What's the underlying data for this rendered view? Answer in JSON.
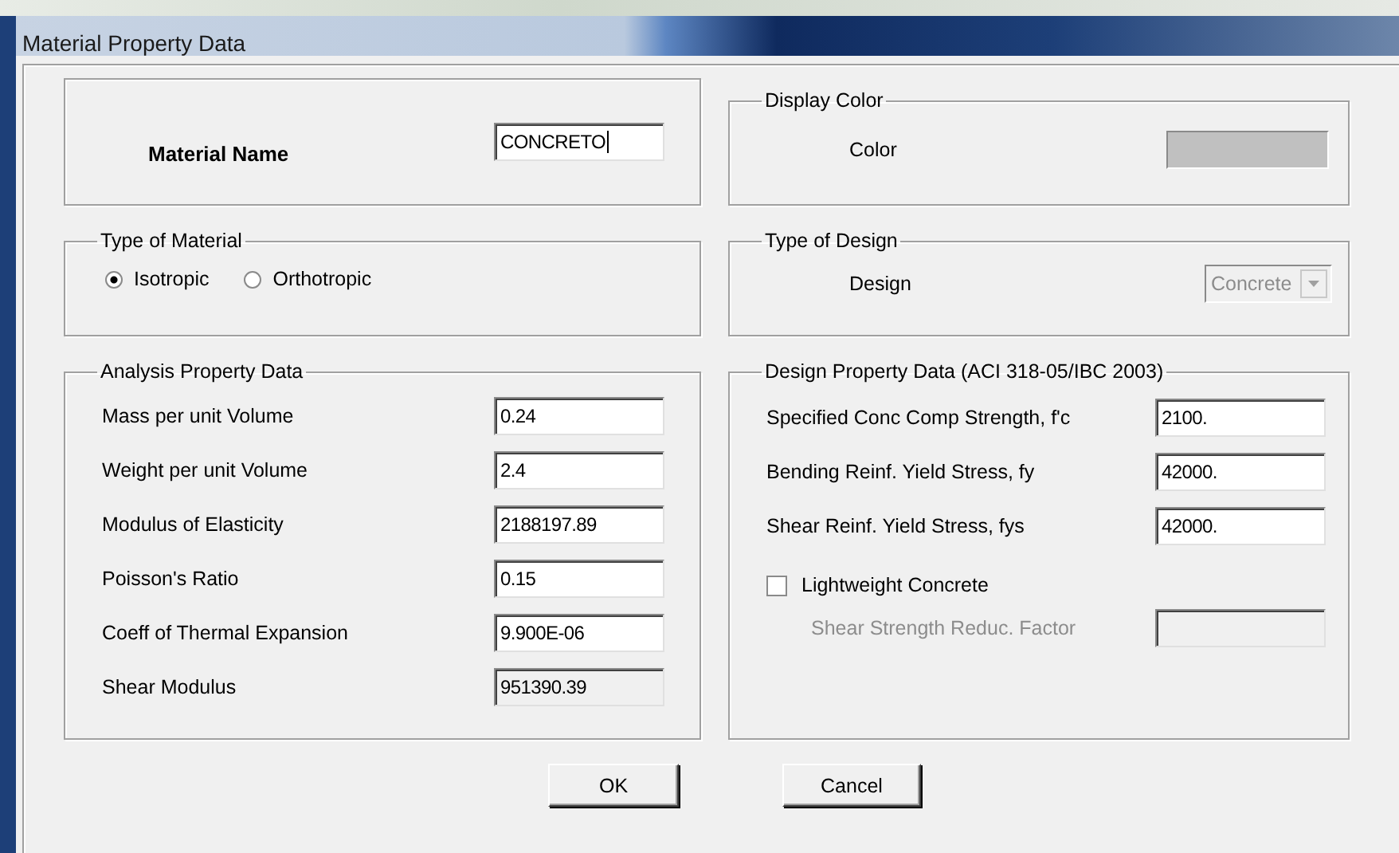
{
  "window": {
    "title": "Material Property Data"
  },
  "material_name": {
    "label": "Material Name",
    "value": "CONCRETO",
    "focused": true
  },
  "type_of_material": {
    "title": "Type of Material",
    "options": [
      {
        "label": "Isotropic",
        "selected": true
      },
      {
        "label": "Orthotropic",
        "selected": false
      }
    ]
  },
  "analysis_property_data": {
    "title": "Analysis Property Data",
    "rows": [
      {
        "label": "Mass per unit Volume",
        "value": "0.24",
        "disabled": false
      },
      {
        "label": "Weight per unit Volume",
        "value": "2.4",
        "disabled": false
      },
      {
        "label": "Modulus of Elasticity",
        "value": "2188197.89",
        "disabled": false
      },
      {
        "label": "Poisson's Ratio",
        "value": "0.15",
        "disabled": false
      },
      {
        "label": "Coeff of Thermal Expansion",
        "value": "9.900E-06",
        "disabled": false
      },
      {
        "label": "Shear Modulus",
        "value": "951390.39",
        "disabled": true
      }
    ]
  },
  "display_color": {
    "title": "Display Color",
    "label": "Color",
    "color": "#c0c0c0"
  },
  "type_of_design": {
    "title": "Type of Design",
    "label": "Design",
    "value": "Concrete",
    "disabled": true
  },
  "design_property_data": {
    "title": "Design Property Data (ACI 318-05/IBC 2003)",
    "rows": [
      {
        "label": "Specified Conc Comp Strength, f'c",
        "value": "2100.",
        "disabled": false
      },
      {
        "label": "Bending Reinf. Yield Stress, fy",
        "value": "42000.",
        "disabled": false
      },
      {
        "label": "Shear Reinf. Yield Stress, fys",
        "value": "42000.",
        "disabled": false
      }
    ],
    "lightweight_concrete": {
      "label": "Lightweight Concrete",
      "checked": false
    },
    "shear_strength_reduction": {
      "label": "Shear Strength Reduc. Factor",
      "disabled": true
    }
  },
  "buttons": [
    "OK",
    "Cancel"
  ]
}
